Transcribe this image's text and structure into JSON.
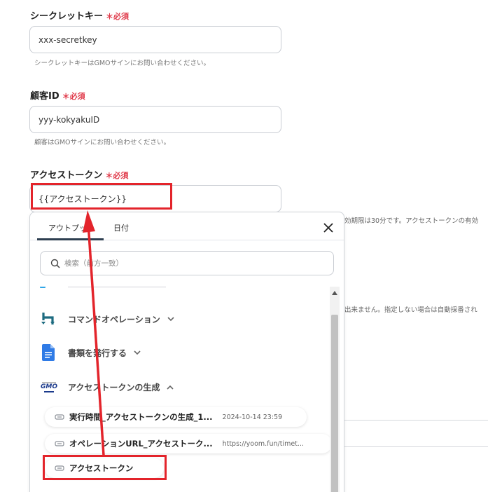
{
  "form": {
    "secret_key": {
      "label": "シークレットキー",
      "required": "＊必須",
      "value": "xxx-secretkey",
      "help": "シークレットキーはGMOサインにお問い合わせください。"
    },
    "customer_id": {
      "label": "顧客ID",
      "required": "＊必須",
      "value": "yyy-kokyakuID",
      "help": "顧客はGMOサインにお問い合わせください。"
    },
    "access_token": {
      "label": "アクセストークン",
      "required": "＊必須",
      "value": "{{アクセストークン}}",
      "help_overflow": "効期限は30分です。アクセストークンの有効"
    },
    "other_help_overflow": "出来ません。指定しない場合は自動採番され"
  },
  "picker": {
    "tabs": [
      {
        "label": "アウトプット",
        "active": true
      },
      {
        "label": "日付",
        "active": false
      }
    ],
    "search_placeholder": "検索（前方一致）",
    "groups": [
      {
        "label": "コマンドオペレーション",
        "icon": "command-operation-icon",
        "expanded": false
      },
      {
        "label": "書類を発行する",
        "icon": "google-docs-icon",
        "expanded": false
      },
      {
        "label": "アクセストークンの生成",
        "icon": "gmo-sign-logo",
        "logo_text": "GMO",
        "expanded": true
      }
    ],
    "items": [
      {
        "label": "実行時間_アクセストークンの生成_1...",
        "value": "2024-10-14 23:59"
      },
      {
        "label": "オペレーションURL_アクセストーク...",
        "value": "https://yoom.fun/timet..."
      },
      {
        "label": "アクセストークン",
        "value": ""
      }
    ]
  },
  "colors": {
    "accent": "#2d3e50",
    "required": "#e03a4a",
    "annotation": "#e3242b"
  }
}
